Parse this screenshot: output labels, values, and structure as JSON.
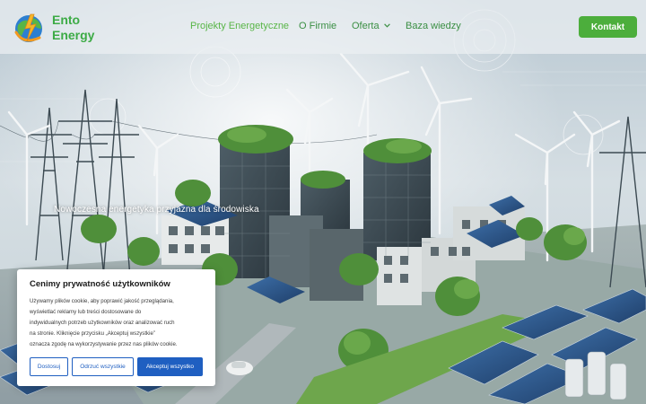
{
  "brand": {
    "line1": "Ento",
    "line2": "Energy"
  },
  "nav": {
    "items": [
      {
        "label": "Projekty Energetyczne",
        "active": true
      },
      {
        "label": "O Firmie",
        "active": false
      },
      {
        "label": "Oferta",
        "active": false,
        "has_dropdown": true
      },
      {
        "label": "Baza wiedzy",
        "active": false
      }
    ],
    "contact_label": "Kontakt"
  },
  "hero": {
    "tagline": "Nowoczesna energetyka przyjazna dla środowiska"
  },
  "cookie": {
    "title": "Cenimy prywatność użytkowników",
    "lines": [
      "Używamy plików cookie, aby poprawić jakość przeglądania,",
      "wyświetlać reklamy lub treści dostosowane do",
      "indywidualnych potrzeb użytkowników oraz analizować ruch",
      "na stronie. Kliknięcie przycisku „Akceptuj wszystkie”",
      "oznacza zgodę na wykorzystywanie przez nas plików cookie."
    ],
    "btn_customize": "Dostosuj",
    "btn_reject": "Odrzuć wszystkie",
    "btn_accept": "Akceptuj wszystko"
  },
  "colors": {
    "brand_green": "#3cab45",
    "nav_green": "#3b8f44",
    "contact_bg": "#4cae3c",
    "cookie_blue": "#1f5fc1"
  }
}
